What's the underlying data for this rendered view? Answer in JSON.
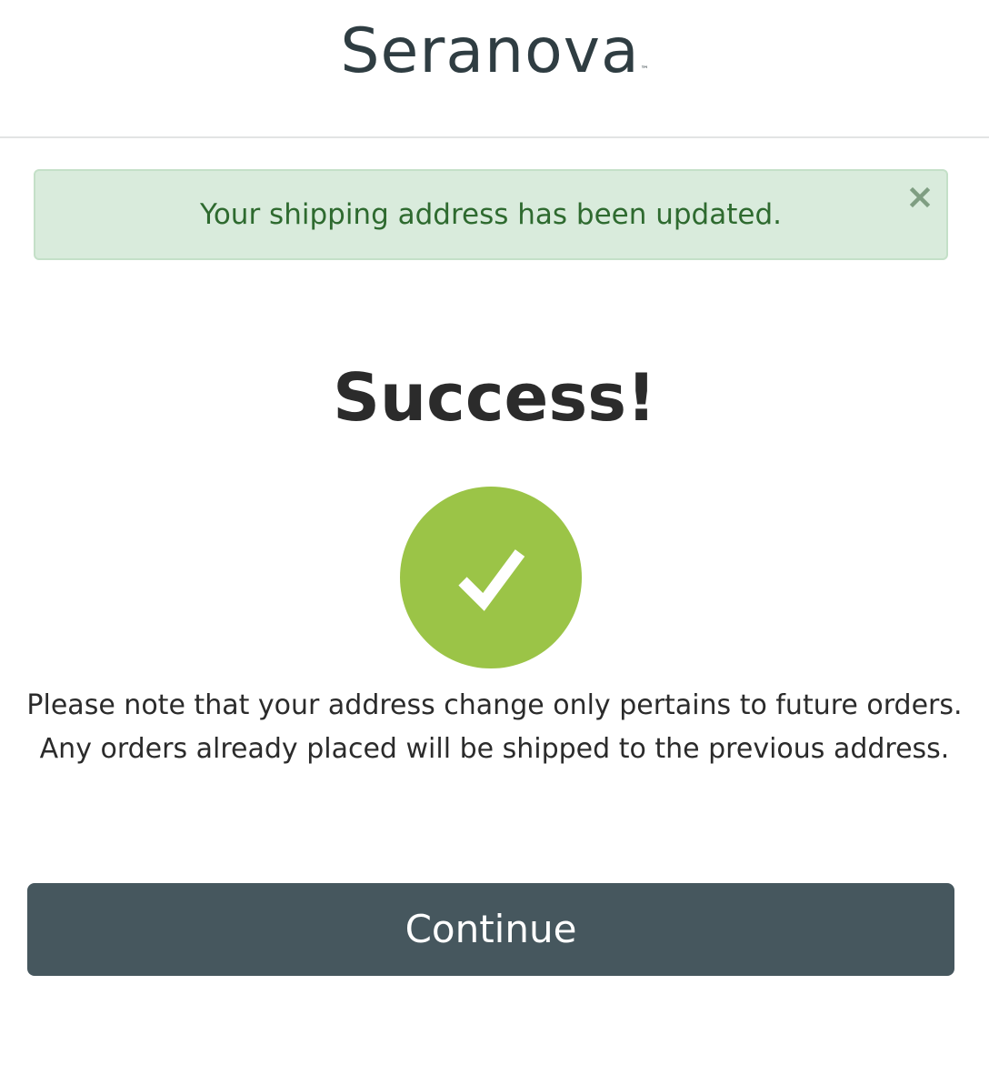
{
  "header": {
    "logo_text": "Seranova",
    "logo_tm": "™"
  },
  "alert": {
    "message": "Your shipping address has been updated.",
    "close_icon": "close-icon"
  },
  "main": {
    "title": "Success!",
    "status_icon": "checkmark-icon",
    "note_line1": "Please note that your address change only pertains to future orders.",
    "note_line2": "Any orders already placed will be shipped to the previous address.",
    "continue_label": "Continue"
  },
  "colors": {
    "alert_bg": "#d9ebdc",
    "alert_text": "#2e6a2f",
    "success_green": "#9bc447",
    "button_bg": "#46575e",
    "logo": "#2f3d42"
  }
}
